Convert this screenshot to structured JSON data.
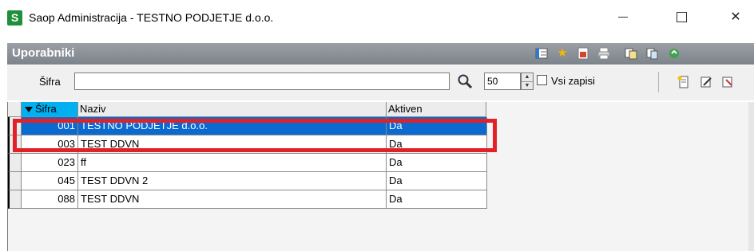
{
  "window": {
    "app_logo_letter": "S",
    "title": "Saop Administracija - TESTNO PODJETJE d.o.o.",
    "close_glyph": "✕"
  },
  "module": {
    "title": "Uporabniki"
  },
  "filter": {
    "sifra_label": "Šifra",
    "search_value": "",
    "count_value": "50",
    "show_all_label": "Vsi zapisi",
    "show_all_checked": false
  },
  "grid": {
    "columns": [
      "Šifra",
      "Naziv",
      "Aktiven"
    ],
    "sorted_column": "Šifra",
    "rows": [
      {
        "sifra": "001",
        "naziv": "TESTNO PODJETJE d.o.o.",
        "aktiven": "Da",
        "selected": true
      },
      {
        "sifra": "003",
        "naziv": "TEST DDVN",
        "aktiven": "Da",
        "selected": false
      },
      {
        "sifra": "023",
        "naziv": "ff",
        "aktiven": "Da",
        "selected": false
      },
      {
        "sifra": "045",
        "naziv": "TEST DDVN 2",
        "aktiven": "Da",
        "selected": false
      },
      {
        "sifra": "088",
        "naziv": "TEST DDVN",
        "aktiven": "Da",
        "selected": false
      }
    ]
  },
  "colors": {
    "selection": "#0a6ad0",
    "sorted_header": "#00b0f0",
    "highlight_box": "#e22028",
    "logo": "#1f8f3a"
  }
}
